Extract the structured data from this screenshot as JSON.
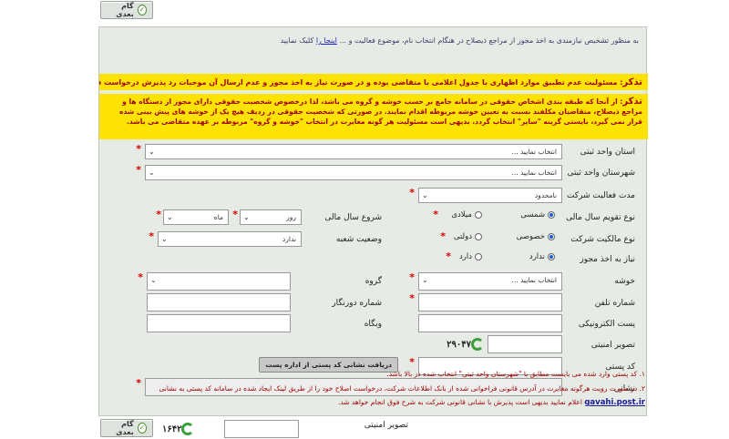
{
  "nav": {
    "next_label": "گام بعدی"
  },
  "intro": {
    "before_link": "به منظور تشخیص نیازمندی به اخذ مجوز از مراجع ذیصلاح در هنگام انتخاب نام، موضوع فعالیت و ... ",
    "link": "اینجا را",
    "after_link": " کلیک نمایید"
  },
  "warnings": {
    "first_title": "تذکر",
    "first_text": ": مسئولیت عدم تطبیق موارد اظهاری با جدول اعلامی با متقاضی بوده و در صورت نیاز به اخذ مجوز و عدم ارسال آن موجبات رد پذیرش درخواست فراهم خواهد شد.",
    "second_title": "تذکر",
    "second_text": ": از آنجا که طبقه بندی اشخاص حقوقی در سامانه جامع بر حسب خوشه و گروه می باشد، لذا درخصوص شخصیت حقوقی دارای مجوز از دستگاه ها و مراجع ذیصلاح، متقاضیان مکلفند نسبت به تعیین خوشه مربوطه اقدام نمایند. در صورتی که شخصیت حقوقی در ردیف هیچ یک از خوشه های پیش بینی شده قرار نمی گیرد، بایستی گزینه \"سایر\" انتخاب گردد. بدیهی است مسئولیت هر گونه مغایرت در انتخاب \"خوشه و گروه\" مربوطه بر عهده متقاضی می باشد."
  },
  "form": {
    "province_label": "استان واحد ثبتی",
    "province_value": "انتخاب نمایید ...",
    "city_label": "شهرستان واحد ثبتی",
    "city_value": "انتخاب نمایید ...",
    "duration_label": "مدت فعالیت شرکت",
    "duration_value": "نامحدود",
    "calendar_label": "نوع تقویم سال مالی",
    "calendar_shamsi": "شمسی",
    "calendar_miladi": "میلادی",
    "fiscal_start_label": "شروع سال مالی",
    "fiscal_month": "ماه",
    "fiscal_day": "روز",
    "ownership_label": "نوع مالکیت شرکت",
    "ownership_private": "خصوصی",
    "ownership_state": "دولتی",
    "branch_label": "وضعیت شعبه",
    "branch_value": "ندارد",
    "license_label": "نیاز به اخذ مجوز",
    "license_no": "ندارد",
    "license_yes": "دارد",
    "cluster_label": "خوشه",
    "cluster_value": "انتخاب نمایید ...",
    "group_label": "گروه",
    "phone_label": "شماره تلفن",
    "fax_label": "شماره دورنگار",
    "email_label": "پست الکترونیکی",
    "website_label": "وبگاه",
    "captcha_label": "تصویر امنیتی",
    "captcha_text": "۲۹۰۴۷",
    "postal_label": "کد پستی",
    "postal_button": "دریافت نشانی کد پستی از اداره پست",
    "address_label": "نشانی"
  },
  "notes": {
    "note1": "۱. کد پستی وارد شده می بایست مطابق با \"شهرستان واحد ثبتی\" انتخاب شده در بالا باشد.",
    "note2": "۲. در صورت رویت هرگونه مغایرت در آدرس قانونی فراخوانی شده از بانک اطلاعات شرکت، درخواست اصلاح خود را از طریق لینک ایجاد شده در سامانه کد پستی به نشانی",
    "note3_link": "gavahi.post.ir",
    "note3_text": " اعلام نمایید بدیهی است پذیرش با نشانی قانونی شرکت به شرح فوق انجام خواهد شد."
  },
  "footer": {
    "captcha_label": "تصویر امنیتی",
    "captcha_text": "۱۶۴۲"
  },
  "colors": {
    "warning_bg": "#fde303",
    "warning_text": "#a30000",
    "panel_bg": "#e7ebe5"
  }
}
